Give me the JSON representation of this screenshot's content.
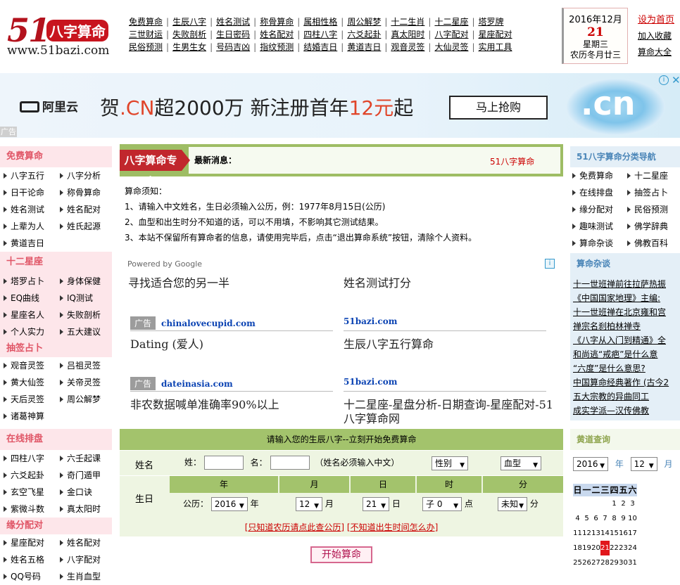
{
  "logo": {
    "number": "51",
    "brand": "八字算命",
    "url": "www.51bazi.com"
  },
  "topnav": [
    [
      "免费算命",
      "生辰八字",
      "姓名测试",
      "称骨算命",
      "属相性格",
      "周公解梦",
      "十二生肖",
      "十二星座",
      "塔罗牌"
    ],
    [
      "三世财运",
      "失败剖析",
      "生日密码",
      "姓名配对",
      "四柱八字",
      "六爻起卦",
      "真太阳时",
      "八字配对",
      "星座配对"
    ],
    [
      "民俗预测",
      "生男生女",
      "号码吉凶",
      "指纹预测",
      "结婚吉日",
      "黄道吉日",
      "观音灵签",
      "大仙灵签",
      "实用工具"
    ]
  ],
  "datebox": {
    "ym": "2016年12月",
    "day": "21",
    "weekday": "星期三",
    "lunar": "农历冬月廿三"
  },
  "toplinks": [
    "设为首页",
    "加入收藏",
    "算命大全"
  ],
  "banner": {
    "brand": "阿里云",
    "slogan_a": "贺",
    "slogan_b": ".CN",
    "slogan_c": "超2000万  新注册首年",
    "slogan_d": "12元",
    "slogan_e": "起",
    "button": "马上抢购",
    "cn": ".cn",
    "ad_tag": "广告"
  },
  "left": {
    "s1": {
      "title": "免费算命",
      "items": [
        "八字五行",
        "八字分析",
        "日干论命",
        "称骨算命",
        "姓名测试",
        "姓名配对",
        "上辈为人",
        "姓氏起源",
        "黄道吉日"
      ]
    },
    "s2": {
      "title": "十二星座",
      "items": [
        "塔罗占卜",
        "身体保健",
        "EQ曲线",
        "IQ测试",
        "星座名人",
        "失败剖析",
        "个人实力",
        "五大建议"
      ]
    },
    "s3": {
      "title": "抽签占卜",
      "items": [
        "观音灵签",
        "吕祖灵签",
        "黄大仙签",
        "关帝灵签",
        "天后灵签",
        "周公解梦",
        "诸葛神算"
      ]
    },
    "s4": {
      "title": "在线排盘",
      "items": [
        "四柱八字",
        "六壬起课",
        "六爻起卦",
        "奇门遁甲",
        "玄空飞星",
        "金口诀",
        "紫微斗数",
        "真太阳时"
      ]
    },
    "s5": {
      "title": "缘分配对",
      "items": [
        "星座配对",
        "姓名配对",
        "姓名五格",
        "八字配对",
        "QQ号码",
        "生肖血型"
      ]
    }
  },
  "center": {
    "tag": "八字算命专家",
    "news_label": "最新消息：",
    "marquee": "51八字算命",
    "notice": [
      "算命须知：",
      "1、请输入中文姓名，生日必须输入公历，例：1977年8月15日(公历)",
      "2、血型和出生时分不知道的话，可以不用填，不影响其它测试结果。",
      "3、本站不保留所有算命者的信息，请使用完毕后，点击“退出算命系统”按钮，清除个人资料。"
    ],
    "ads": {
      "powered": "Powered by Google",
      "a1": "寻找适合您的另一半",
      "a2": "姓名测试打分",
      "label": "广告",
      "src3": "chinalovecupid.com",
      "desc3": "Dating (爱人)",
      "src4": "51bazi.com",
      "desc4": "生辰八字五行算命",
      "src5": "dateinasia.com",
      "desc5": "非农数据喊单准确率90%以上",
      "src6": "51bazi.com",
      "desc6": "十二星座-星盘分析-日期查询-星座配对-51八字算命网"
    },
    "form": {
      "title": "请输入您的生辰八字--立刻开始免费算命",
      "name_label": "姓名",
      "surname": "姓：",
      "given": "名：",
      "hint": "（姓名必须输入中文）",
      "gender": "性别",
      "blood": "血型",
      "birth_label": "生日",
      "cols": [
        "年",
        "月",
        "日",
        "时",
        "分"
      ],
      "calendar": "公历：",
      "year": "2016",
      "year_unit": "年",
      "month": "12",
      "month_unit": "月",
      "day": "21",
      "day_unit": "日",
      "hour": "子 0",
      "hour_unit": "点",
      "minute": "未知",
      "minute_unit": "分",
      "link1": "[只知道农历请点此查公历]",
      "link2": "[不知道出生时间怎么办]",
      "submit": "开始算命"
    }
  },
  "right": {
    "nav_title": "51八字算命分类导航",
    "nav_items": [
      "免费算命",
      "十二星座",
      "在线排盘",
      "抽签占卜",
      "缘分配对",
      "民俗预测",
      "趣味测试",
      "佛学辞典",
      "算命杂谈",
      "佛教百科"
    ],
    "talk_title": "算命杂谈",
    "talk_items": [
      "十一世班禅前往拉萨热振",
      "《中国国家地理》主编:",
      "十一世班禅在北京雍和宫",
      "禅宗名刹柏林禅寺",
      "《八字从入门到精通》全",
      "和尚逃“戒疤”是什么意",
      "“六度”是什么意思?",
      "中国算命经典著作 (古今2",
      "五大宗教的异曲同工",
      "成实学派—汉传佛教"
    ],
    "cal_title": "黄道查询",
    "cal_year": "2016",
    "cal_year_unit": "年",
    "cal_month": "12",
    "cal_month_unit": "月",
    "weekdays": [
      "日",
      "一",
      "二",
      "三",
      "四",
      "五",
      "六"
    ],
    "days": [
      "",
      "",
      "",
      "",
      "1",
      "2",
      "3",
      "4",
      "5",
      "6",
      "7",
      "8",
      "9",
      "10",
      "11",
      "12",
      "13",
      "14",
      "15",
      "16",
      "17",
      "18",
      "19",
      "20",
      "21",
      "22",
      "23",
      "24",
      "25",
      "26",
      "27",
      "28",
      "29",
      "30",
      "31"
    ],
    "today": "21"
  }
}
